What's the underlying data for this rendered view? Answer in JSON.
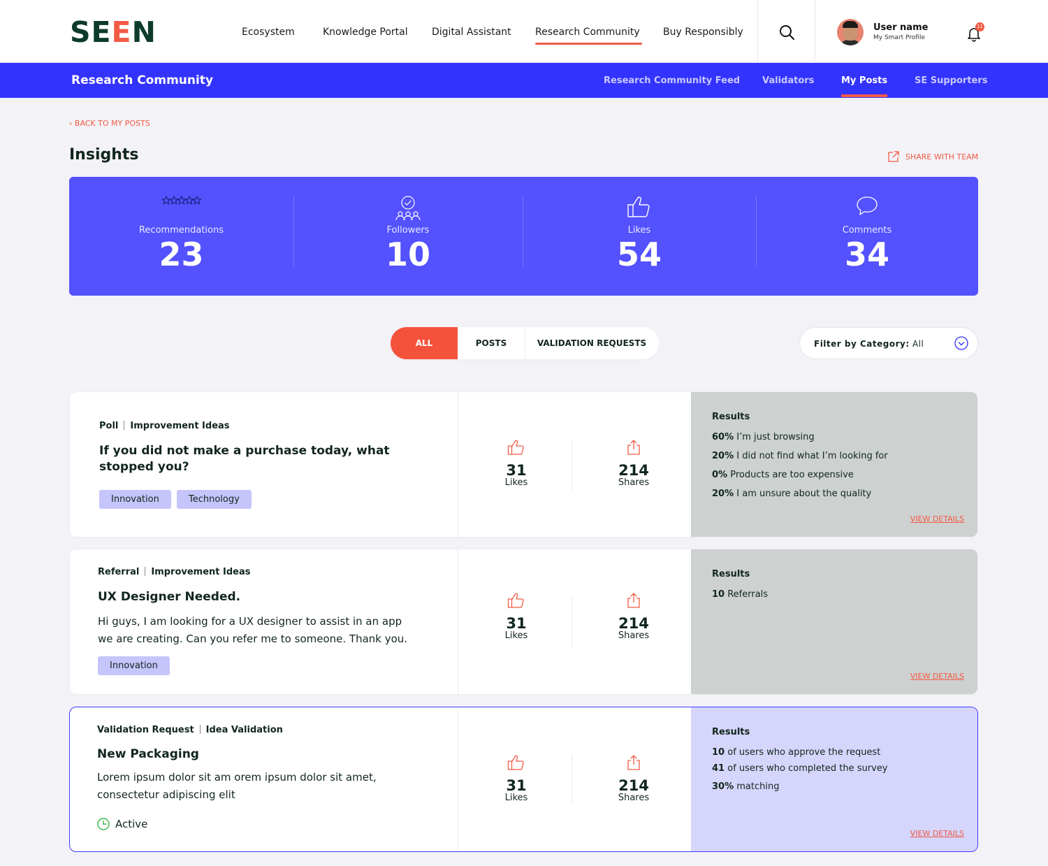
{
  "brand": {
    "logo_text": "SEEN",
    "accent": "#f25a45",
    "primary": "#3333ff"
  },
  "topnav": {
    "items": [
      "Ecosystem",
      "Knowledge Portal",
      "Digital Assistant",
      "Research Community",
      "Buy Responsibly"
    ],
    "active": "Research Community"
  },
  "user": {
    "name": "User name",
    "subtitle": "My Smart Profile",
    "notifications": "11"
  },
  "subnav": {
    "title": "Research Community",
    "items": [
      "Research Community Feed",
      "Validators",
      "My Posts",
      "SE Supporters"
    ],
    "active": "My Posts"
  },
  "page": {
    "back_label": "BACK TO MY POSTS",
    "title": "Insights",
    "share_label": "SHARE WITH TEAM"
  },
  "stats": [
    {
      "label": "Recommendations",
      "value": "23",
      "icon": "stars-icon"
    },
    {
      "label": "Followers",
      "value": "10",
      "icon": "followers-icon"
    },
    {
      "label": "Likes",
      "value": "54",
      "icon": "thumbs-up-icon"
    },
    {
      "label": "Comments",
      "value": "34",
      "icon": "comment-icon"
    }
  ],
  "tabs": {
    "items": [
      "ALL",
      "POSTS",
      "VALIDATION REQUESTS"
    ],
    "active": "ALL"
  },
  "filter": {
    "label": "Filter by Category:",
    "value": "All"
  },
  "cards": [
    {
      "type": "Poll",
      "category": "Improvement Ideas",
      "title": "If you did not make a purchase today, what stopped you?",
      "tags": [
        "Innovation",
        "Technology"
      ],
      "likes": "31",
      "likes_label": "Likes",
      "shares": "214",
      "shares_label": "Shares",
      "results_title": "Results",
      "results": [
        {
          "value": "60%",
          "text": "I’m just browsing"
        },
        {
          "value": "20%",
          "text": "I did not find what I’m looking for"
        },
        {
          "value": "0%",
          "text": "Products are too expensive"
        },
        {
          "value": "20%",
          "text": "I am unsure about the quality"
        }
      ],
      "view_label": "VIEW DETAILS"
    },
    {
      "type": "Referral",
      "category": "Improvement Ideas",
      "title": "UX Designer Needed.",
      "body": "Hi guys, I am looking for a UX designer to assist in an app we are creating. Can you refer me to someone. Thank you.",
      "tags": [
        "Innovation"
      ],
      "likes": "31",
      "likes_label": "Likes",
      "shares": "214",
      "shares_label": "Shares",
      "results_title": "Results",
      "results": [
        {
          "value": "10",
          "text": "Referrals"
        }
      ],
      "view_label": "VIEW DETAILS"
    },
    {
      "type": "Validation Request",
      "category": "Idea Validation",
      "title": "New Packaging",
      "body": "Lorem ipsum dolor sit am orem ipsum dolor sit amet, consectetur adipiscing elit",
      "status": "Active",
      "likes": "31",
      "likes_label": "Likes",
      "shares": "214",
      "shares_label": "Shares",
      "results_title": "Results",
      "results": [
        {
          "value": "10",
          "text": "of users who approve the request"
        },
        {
          "value": "41",
          "text": "of users who completed the survey"
        },
        {
          "value": "30%",
          "text": "matching"
        }
      ],
      "view_label": "VIEW DETAILS"
    }
  ]
}
